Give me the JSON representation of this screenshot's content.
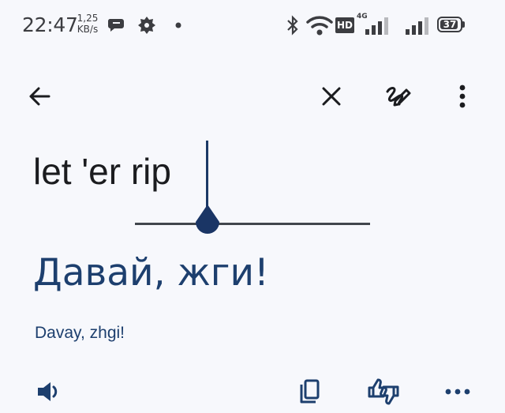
{
  "status_bar": {
    "time": "22:47",
    "speed_value": "1,25",
    "speed_unit": "KB/s",
    "network_badge": "HD",
    "network_type": "4G",
    "battery": "37"
  },
  "toolbar": {
    "back_icon": "arrow-left-icon",
    "clear_icon": "close-icon",
    "handwriting_icon": "handwriting-icon",
    "more_icon": "more-vert-icon"
  },
  "input": {
    "text": "let 'er rip"
  },
  "output": {
    "translation": "Давай, жги!",
    "transliteration": "Davay, zhgi!"
  },
  "actions": {
    "speak_icon": "volume-icon",
    "copy_icon": "copy-icon",
    "feedback_icon": "thumbs-feedback-icon",
    "more_icon": "more-horiz-icon"
  },
  "colors": {
    "background": "#f7f8fc",
    "accent": "#1d3f6e",
    "text": "#1b1c1f"
  }
}
